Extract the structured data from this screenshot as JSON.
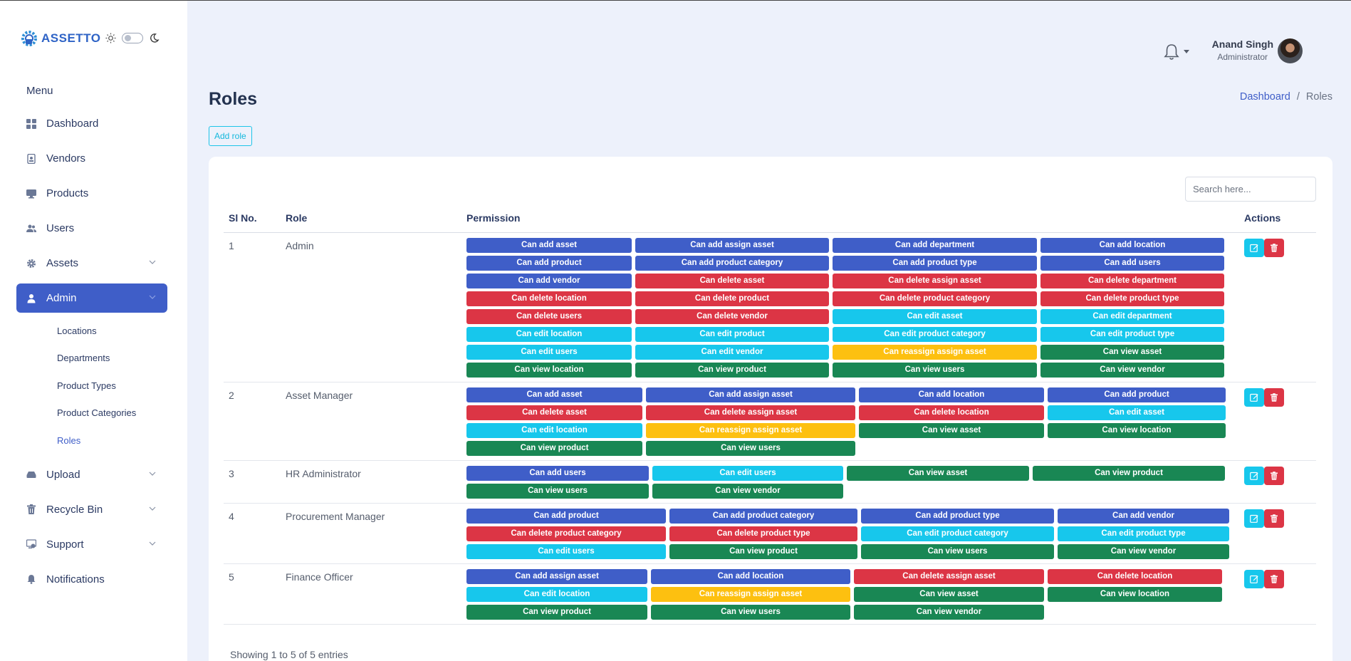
{
  "brand": {
    "name": "ASSETTO"
  },
  "sidebar": {
    "menu_title": "Menu",
    "items": [
      {
        "label": "Dashboard",
        "icon": "grid-icon"
      },
      {
        "label": "Vendors",
        "icon": "id-badge-icon"
      },
      {
        "label": "Products",
        "icon": "monitor-icon"
      },
      {
        "label": "Users",
        "icon": "users-icon"
      },
      {
        "label": "Assets",
        "icon": "gear-icon"
      },
      {
        "label": "Admin",
        "icon": "user-icon",
        "active": true
      },
      {
        "label": "Upload",
        "icon": "upload-icon"
      },
      {
        "label": "Recycle Bin",
        "icon": "trash-icon"
      },
      {
        "label": "Support",
        "icon": "support-icon"
      },
      {
        "label": "Notifications",
        "icon": "bell-icon"
      }
    ],
    "admin_subitems": [
      {
        "label": "Locations"
      },
      {
        "label": "Departments"
      },
      {
        "label": "Product Types"
      },
      {
        "label": "Product Categories"
      },
      {
        "label": "Roles",
        "active": true
      }
    ]
  },
  "header": {
    "user_name": "Anand Singh",
    "user_role": "Administrator"
  },
  "page": {
    "title": "Roles",
    "breadcrumb": {
      "home": "Dashboard",
      "separator": "/",
      "current": "Roles"
    },
    "add_button": "Add role"
  },
  "search": {
    "placeholder": "Search here..."
  },
  "table": {
    "headers": {
      "sl": "Sl No.",
      "role": "Role",
      "permission": "Permission",
      "actions": "Actions"
    },
    "rows": [
      {
        "sl": "1",
        "role": "Admin",
        "columns": 4,
        "permissions": [
          "Can add asset",
          "Can add assign asset",
          "Can add department",
          "Can add location",
          "Can add product",
          "Can add product category",
          "Can add product type",
          "Can add users",
          "Can add vendor",
          "Can delete asset",
          "Can delete assign asset",
          "Can delete department",
          "Can delete location",
          "Can delete product",
          "Can delete product category",
          "Can delete product type",
          "Can delete users",
          "Can delete vendor",
          "Can edit asset",
          "Can edit department",
          "Can edit location",
          "Can edit product",
          "Can edit product category",
          "Can edit product type",
          "Can edit users",
          "Can edit vendor",
          "Can reassign assign asset",
          "Can view asset",
          "Can view location",
          "Can view product",
          "Can view users",
          "Can view vendor"
        ]
      },
      {
        "sl": "2",
        "role": "Asset Manager",
        "columns": 4,
        "permissions": [
          "Can add asset",
          "Can add assign asset",
          "Can add location",
          "Can add product",
          "Can delete asset",
          "Can delete assign asset",
          "Can delete location",
          "Can edit asset",
          "Can edit location",
          "Can reassign assign asset",
          "Can view asset",
          "Can view location",
          "Can view product",
          "Can view users"
        ]
      },
      {
        "sl": "3",
        "role": "HR Administrator",
        "columns": 4,
        "permissions": [
          "Can add users",
          "Can edit users",
          "Can view asset",
          "Can view product",
          "Can view users",
          "Can view vendor"
        ]
      },
      {
        "sl": "4",
        "role": "Procurement Manager",
        "columns": 4,
        "permissions": [
          "Can add product",
          "Can add product category",
          "Can add product type",
          "Can add vendor",
          "Can delete product category",
          "Can delete product type",
          "Can edit product category",
          "Can edit product type",
          "Can edit users",
          "Can view product",
          "Can view users",
          "Can view vendor"
        ]
      },
      {
        "sl": "5",
        "role": "Finance Officer",
        "columns": 4,
        "permissions": [
          "Can add assign asset",
          "Can add location",
          "Can delete assign asset",
          "Can delete location",
          "Can edit location",
          "Can reassign assign asset",
          "Can view asset",
          "Can view location",
          "Can view product",
          "Can view users",
          "Can view vendor"
        ]
      }
    ]
  },
  "footer": {
    "info": "Showing 1 to 5 of 5 entries"
  },
  "colors": {
    "add": "#3f5ec8",
    "delete": "#dc3545",
    "edit": "#17c7ec",
    "reassign": "#fdc010",
    "view": "#198754",
    "accent": "#3f5ec8"
  }
}
